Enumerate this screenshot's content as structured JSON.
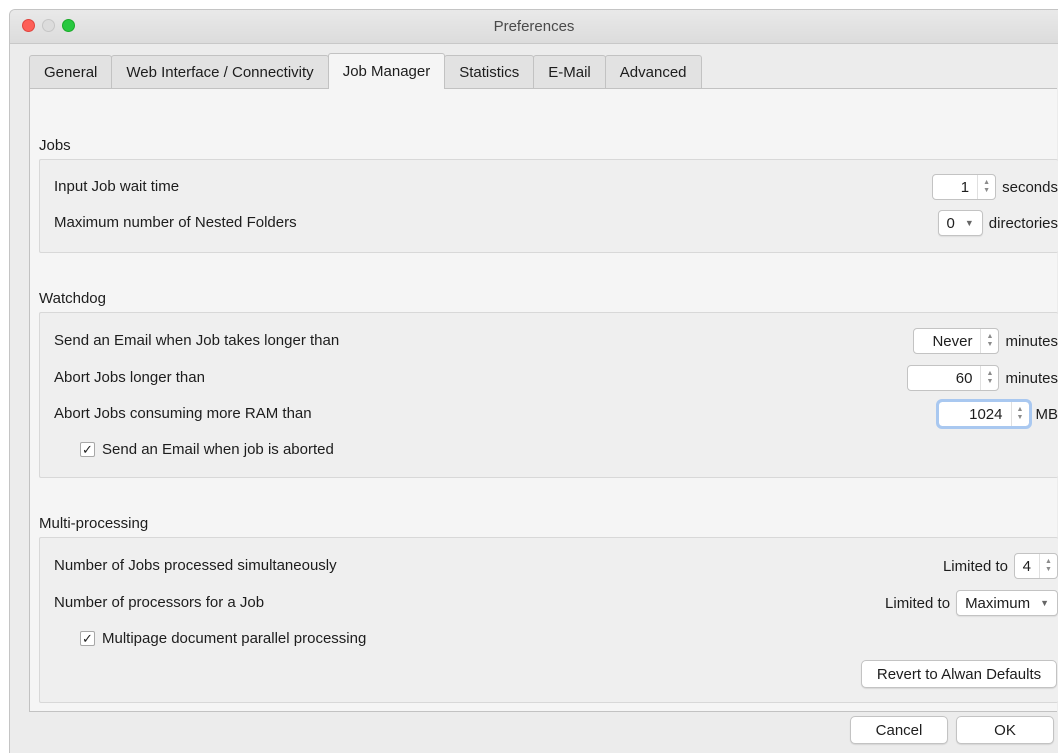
{
  "window": {
    "title": "Preferences"
  },
  "tabs": [
    {
      "label": "General"
    },
    {
      "label": "Web Interface / Connectivity"
    },
    {
      "label": "Job Manager",
      "active": true
    },
    {
      "label": "Statistics"
    },
    {
      "label": "E-Mail"
    },
    {
      "label": "Advanced"
    }
  ],
  "jobs": {
    "title": "Jobs",
    "wait_time": {
      "label": "Input Job wait time",
      "value": "1",
      "unit": "seconds"
    },
    "nested_folders": {
      "label": "Maximum number of Nested Folders",
      "value": "0",
      "unit": "directories"
    }
  },
  "watchdog": {
    "title": "Watchdog",
    "email_longer": {
      "label": "Send an Email when Job takes longer than",
      "value": "Never",
      "unit": "minutes"
    },
    "abort_longer": {
      "label": "Abort Jobs longer than",
      "value": "60",
      "unit": "minutes"
    },
    "abort_ram": {
      "label": "Abort Jobs consuming more RAM than",
      "value": "1024",
      "unit": "MB"
    },
    "email_aborted": {
      "label": "Send an Email when job is aborted",
      "checked": true
    }
  },
  "multiprocessing": {
    "title": "Multi-processing",
    "jobs_simultaneous": {
      "label": "Number of Jobs processed simultaneously",
      "prefix": "Limited to",
      "value": "4"
    },
    "processors": {
      "label": "Number of processors for a Job",
      "prefix": "Limited to",
      "value": "Maximum"
    },
    "multipage": {
      "label": "Multipage document parallel processing",
      "checked": true
    },
    "revert_label": "Revert to Alwan Defaults"
  },
  "footer": {
    "cancel_label": "Cancel",
    "ok_label": "OK"
  },
  "glyphs": {
    "check": "✓",
    "up": "▲",
    "down": "▼",
    "caret": "▼"
  }
}
